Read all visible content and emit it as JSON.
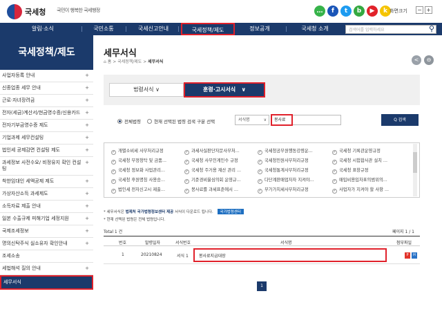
{
  "header": {
    "logo_text": "국세청",
    "slogan": "국민이 행복한 국세행정",
    "font_size_label": "화면크기",
    "font_minus": "−",
    "font_plus": "+",
    "social": [
      {
        "name": "chat-icon",
        "color": "#37b34a",
        "glyph": "…"
      },
      {
        "name": "facebook-icon",
        "color": "#1a55b8",
        "glyph": "f"
      },
      {
        "name": "twitter-icon",
        "color": "#1d9bf0",
        "glyph": "t"
      },
      {
        "name": "blog-icon",
        "color": "#35a941",
        "glyph": "b"
      },
      {
        "name": "youtube-icon",
        "color": "#e1222a",
        "glyph": "▶"
      },
      {
        "name": "kakao-icon",
        "color": "#f5c400",
        "glyph": "k"
      }
    ]
  },
  "nav": {
    "items": [
      "알림·소식",
      "국민소통",
      "국세신고안내",
      "국세정책/제도",
      "정보공개",
      "국세청 소개"
    ],
    "search_placeholder": "검색어를 입력하세요",
    "active": "국세정책/제도"
  },
  "sidebar": {
    "title": "국세정책/제도",
    "items": [
      {
        "label": "사업자등록 안내",
        "plus": "+"
      },
      {
        "label": "신종업종 세무 안내",
        "plus": "+"
      },
      {
        "label": "근로·자녀장려금",
        "plus": "+"
      },
      {
        "label": "전자(세금)계산서/현금영수증/신용카드",
        "plus": "+"
      },
      {
        "label": "전자기부금영수증 제도",
        "plus": "+"
      },
      {
        "label": "기업과제 세무컨설팅",
        "plus": "+"
      },
      {
        "label": "법인세 공제감면 컨설팅 제도",
        "plus": "+"
      },
      {
        "label": "과세정보 사전수요/ 비정유지 확인 컨설팅",
        "plus": "+"
      },
      {
        "label": "착한임대인 세액공제 제도",
        "plus": "+"
      },
      {
        "label": "가상자산소득 과세제도",
        "plus": "+"
      },
      {
        "label": "소득자료 제출 안내",
        "plus": "+"
      },
      {
        "label": "일본 수출규제 피해기업 세정지원",
        "plus": "+"
      },
      {
        "label": "국제조세정보",
        "plus": "+"
      },
      {
        "label": "명의신탁주식 실소유자 확인안내",
        "plus": "+"
      },
      {
        "label": "조세소송",
        "plus": ""
      },
      {
        "label": "세법해석 질의 안내",
        "plus": "+"
      },
      {
        "label": "세무서식",
        "plus": ""
      }
    ]
  },
  "main": {
    "title": "세무서식",
    "breadcrumb": {
      "home": "홈",
      "sep": ">",
      "parent": "국세정책/제도",
      "current": "세무서식"
    },
    "circle_buttons": [
      "<",
      "⊖"
    ],
    "tabs": [
      {
        "label": "법령서식",
        "arrow": "∨"
      },
      {
        "label": "훈령·고시서식",
        "arrow": "∨"
      }
    ],
    "filter": {
      "radio1": "전체법령",
      "radio2": "현재 선택된 법령 검색 구분 선택",
      "select_value": "서식명",
      "select_arrow": "∨",
      "input_value": "봉사료",
      "search_button": "Q 검색"
    },
    "checklist": [
      [
        "개별소비세 사무처리규정",
        "과세사실판단자문사무처...",
        "국세청공무원행동강령운...",
        "국세청 기록관운영규정"
      ],
      [
        "국세청 부정청탁 및 금품...",
        "국세청 사무인계인수 규정",
        "국세청민원사무처리규정",
        "국세청 시험합사관 설치 ..."
      ],
      [
        "국세청 정보화 사업관리...",
        "국세청 주거용 재산 관리 ...",
        "국세청통계사무처리규정",
        "국세청 표창규정"
      ],
      [
        "국세청 후원명칭 사용승...",
        "기준경비율심의회 운영규...",
        "다단계판매업자자 지켜야...",
        "매입비용입차표의범위의..."
      ],
      [
        "법인세 전자신고시 제출...",
        "봉사료를 과세표준에서 ...",
        "부가가치세사무처리규정",
        "사업자가 지켜야 할 사항 ..."
      ]
    ],
    "note1": {
      "pre": "* 세무서식은",
      "bold": "법제처 국가법령정보센터 제공",
      "post": "서식이 다운로드 됩니다.",
      "badge": "국가법령센터"
    },
    "note2": "* 현재 선택된 법령은 전체 법령입니다.",
    "total": "Total 1 건",
    "page_info": "페이지 1 / 1",
    "table": {
      "headers": [
        "번호",
        "발령일자",
        "서식번호",
        "서식명",
        "첨부파일"
      ],
      "rows": [
        {
          "no": "1",
          "date": "20210824",
          "form_no": "서식 1",
          "name": "봉사료지급대장",
          "pdf": "P",
          "doc": "H"
        }
      ]
    },
    "pagination": [
      "1"
    ]
  }
}
